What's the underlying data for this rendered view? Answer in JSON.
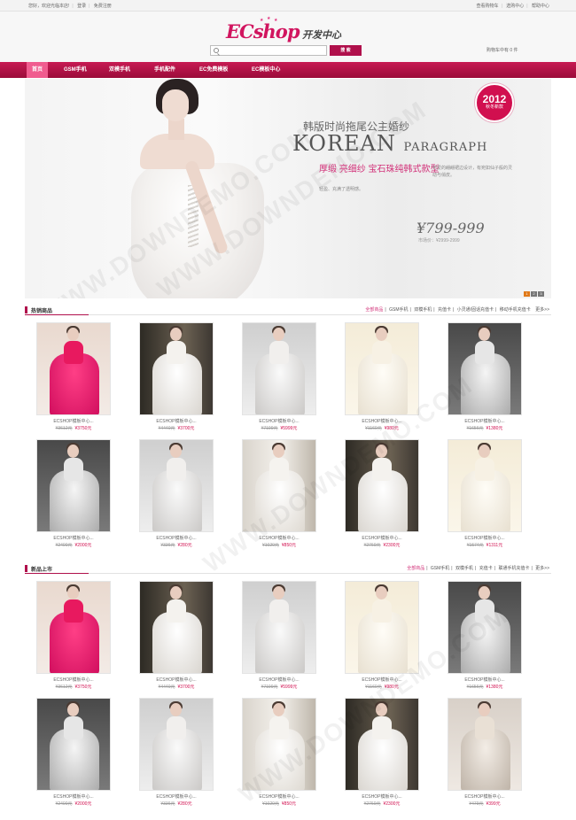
{
  "topbar": {
    "welcome": "您好，欢迎光临本店!",
    "login": "登录",
    "register": "免费注册",
    "links": [
      "查看购物车",
      "选购中心",
      "帮助中心"
    ]
  },
  "header": {
    "logo_main": "ECshop",
    "logo_sub": "开发中心",
    "search_placeholder": "",
    "search_button": "搜 索",
    "cart": "购物车中有 0 件"
  },
  "nav": {
    "items": [
      {
        "label": "首页",
        "active": true
      },
      {
        "label": "GSM手机",
        "active": false
      },
      {
        "label": "双模手机",
        "active": false
      },
      {
        "label": "手机配件",
        "active": false
      },
      {
        "label": "EC免费模板",
        "active": false
      },
      {
        "label": "EC模板中心",
        "active": false
      }
    ]
  },
  "banner": {
    "heading": "韩版时尚拖尾公主婚纱",
    "script_big": "KOREAN",
    "script_small": "PARAGRAPH",
    "tagline": "厚缎 亮细纱 宝石珠纯韩式款型",
    "desc": "可爱的翩翩裙边设计，有宛如仙子般的灵动与俏皮。",
    "desc2": "轻盈、充满了透明感。",
    "price": "¥799-999",
    "old_price": "市场价：¥2999-2999",
    "badge_year": "2012",
    "badge_text": "秋冬新款",
    "dots": [
      "1",
      "2",
      "3"
    ],
    "watermarks": [
      "WWW.DOWNDEMO.COM",
      "WWW.DOWNDEMO.COM",
      "WWW.DOWNDEMO.COM",
      "WWW.DOWNDEMO.COM"
    ]
  },
  "sections": [
    {
      "title": "热销商品",
      "tabs": [
        "全部商品",
        "GSM手机",
        "双模手机",
        "充值卡",
        "小灵通/固话充值卡",
        "移动手机充值卡",
        "更多>>"
      ],
      "products": [
        {
          "name": "ECSHOP模板中心...",
          "old_price": "¥3612元",
          "price": "¥3750元",
          "dress": "pink"
        },
        {
          "name": "ECSHOP模板中心...",
          "old_price": "¥4440元",
          "price": "¥3700元",
          "dress": "white-dark"
        },
        {
          "name": "ECSHOP模板中心...",
          "old_price": "¥7199元",
          "price": "¥5999元",
          "dress": "white"
        },
        {
          "name": "ECSHOP模板中心...",
          "old_price": "¥1160元",
          "price": "¥980元",
          "dress": "cream"
        },
        {
          "name": "ECSHOP模板中心...",
          "old_price": "¥1656元",
          "price": "¥1380元",
          "dress": "grey"
        },
        {
          "name": "ECSHOP模板中心...",
          "old_price": "¥2400元",
          "price": "¥2000元",
          "dress": "grey"
        },
        {
          "name": "ECSHOP模板中心...",
          "old_price": "¥336元",
          "price": "¥280元",
          "dress": "white"
        },
        {
          "name": "ECSHOP模板中心...",
          "old_price": "¥1020元",
          "price": "¥850元",
          "dress": "window"
        },
        {
          "name": "ECSHOP模板中心...",
          "old_price": "¥2760元",
          "price": "¥2300元",
          "dress": "white-dark"
        },
        {
          "name": "ECSHOP模板中心...",
          "old_price": "¥1574元",
          "price": "¥1311元",
          "dress": "cream"
        }
      ]
    },
    {
      "title": "新品上市",
      "tabs": [
        "全部商品",
        "GSM手机",
        "双模手机",
        "充值卡",
        "联通手机充值卡",
        "更多>>"
      ],
      "products": [
        {
          "name": "ECSHOP模板中心...",
          "old_price": "¥3612元",
          "price": "¥3750元",
          "dress": "pink"
        },
        {
          "name": "ECSHOP模板中心...",
          "old_price": "¥4440元",
          "price": "¥3700元",
          "dress": "white-dark"
        },
        {
          "name": "ECSHOP模板中心...",
          "old_price": "¥7199元",
          "price": "¥5999元",
          "dress": "white"
        },
        {
          "name": "ECSHOP模板中心...",
          "old_price": "¥1160元",
          "price": "¥980元",
          "dress": "cream"
        },
        {
          "name": "ECSHOP模板中心...",
          "old_price": "¥1656元",
          "price": "¥1380元",
          "dress": "grey"
        },
        {
          "name": "ECSHOP模板中心...",
          "old_price": "¥2400元",
          "price": "¥2000元",
          "dress": "grey"
        },
        {
          "name": "ECSHOP模板中心...",
          "old_price": "¥336元",
          "price": "¥280元",
          "dress": "white"
        },
        {
          "name": "ECSHOP模板中心...",
          "old_price": "¥1020元",
          "price": "¥850元",
          "dress": "window"
        },
        {
          "name": "ECSHOP模板中心...",
          "old_price": "¥2760元",
          "price": "¥2300元",
          "dress": "white-dark"
        },
        {
          "name": "ECSHOP模板中心...",
          "old_price": "¥479元",
          "price": "¥399元",
          "dress": "beige"
        }
      ]
    }
  ],
  "colors": {
    "brand": "#b0104c",
    "accent": "#d10f4f",
    "nav_active": "#f05c8f"
  }
}
